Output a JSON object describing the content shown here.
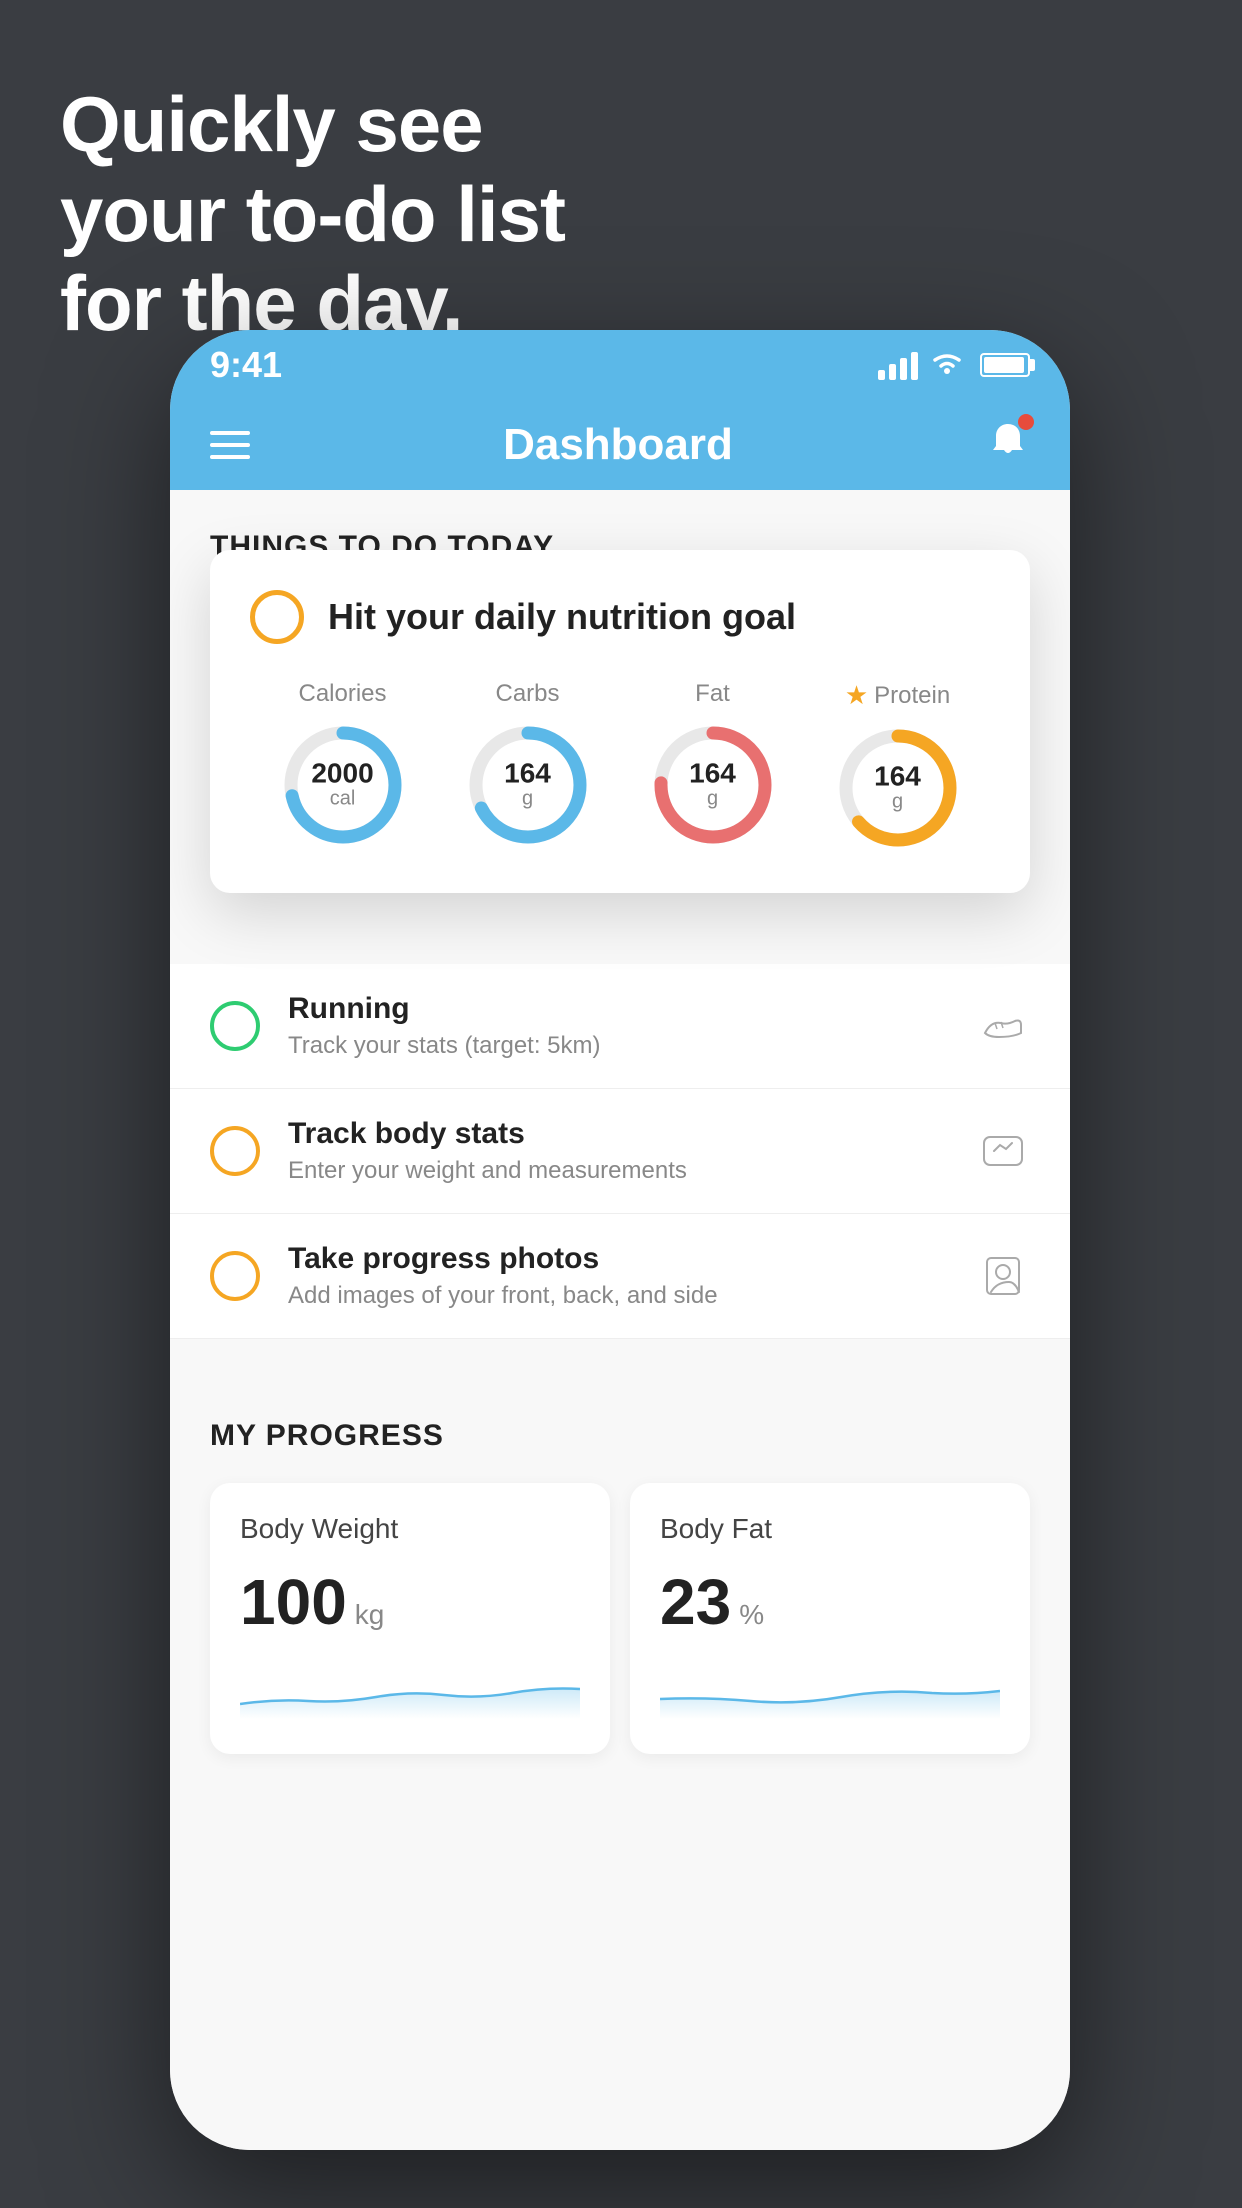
{
  "background": {
    "color": "#3a3d42"
  },
  "headline": {
    "line1": "Quickly see",
    "line2": "your to-do list",
    "line3": "for the day."
  },
  "status_bar": {
    "time": "9:41",
    "color": "#5bb8e8"
  },
  "nav_bar": {
    "title": "Dashboard",
    "color": "#5bb8e8"
  },
  "section_header": {
    "label": "THINGS TO DO TODAY"
  },
  "floating_card": {
    "title": "Hit your daily nutrition goal",
    "nutrition": [
      {
        "label": "Calories",
        "value": "2000",
        "unit": "cal",
        "color": "#5bb8e8",
        "star": false
      },
      {
        "label": "Carbs",
        "value": "164",
        "unit": "g",
        "color": "#5bb8e8",
        "star": false
      },
      {
        "label": "Fat",
        "value": "164",
        "unit": "g",
        "color": "#e87070",
        "star": false
      },
      {
        "label": "Protein",
        "value": "164",
        "unit": "g",
        "color": "#f5a623",
        "star": true
      }
    ]
  },
  "todo_items": [
    {
      "title": "Running",
      "subtitle": "Track your stats (target: 5km)",
      "circle_color": "green",
      "icon": "shoe"
    },
    {
      "title": "Track body stats",
      "subtitle": "Enter your weight and measurements",
      "circle_color": "yellow",
      "icon": "scale"
    },
    {
      "title": "Take progress photos",
      "subtitle": "Add images of your front, back, and side",
      "circle_color": "yellow",
      "icon": "person"
    }
  ],
  "progress": {
    "title": "MY PROGRESS",
    "cards": [
      {
        "title": "Body Weight",
        "value": "100",
        "unit": "kg"
      },
      {
        "title": "Body Fat",
        "value": "23",
        "unit": "%"
      }
    ]
  }
}
